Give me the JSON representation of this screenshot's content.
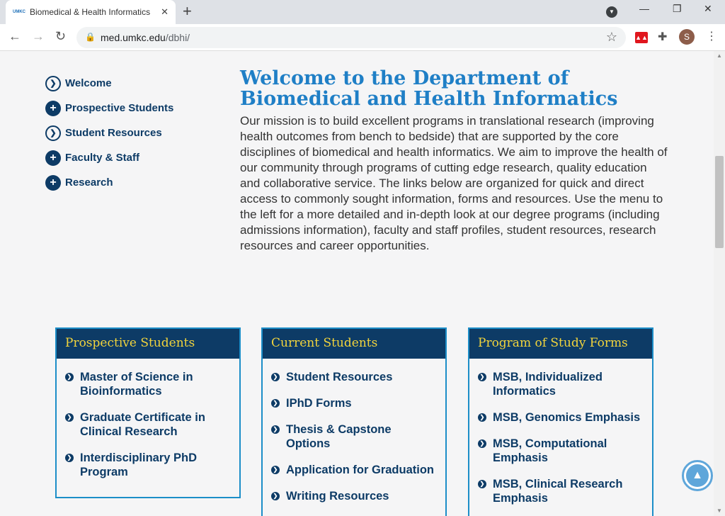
{
  "browser": {
    "tab_title": "Biomedical & Health Informatics",
    "favicon_text": "UMKC",
    "url_host": "med.umkc.edu",
    "url_path": "/dbhi/",
    "avatar_initial": "S"
  },
  "sidebar": {
    "items": [
      {
        "label": "Welcome",
        "icon": "chevron-circle-icon"
      },
      {
        "label": "Prospective Students",
        "icon": "plus-circle-icon"
      },
      {
        "label": "Student Resources",
        "icon": "chevron-circle-icon"
      },
      {
        "label": "Faculty & Staff",
        "icon": "plus-circle-icon"
      },
      {
        "label": "Research",
        "icon": "plus-circle-icon"
      }
    ]
  },
  "main": {
    "heading": "Welcome to the Department of Biomedical and Health Informatics",
    "mission": "Our mission is to build excellent programs in translational research (improving health outcomes from bench to bedside) that are supported by the core disciplines of biomedical and health informatics. We aim to improve the health of our community through programs of cutting edge research, quality education and collaborative service. The links below are organized for quick and direct access to commonly sought information, forms and resources.  Use the menu to the left for a more detailed and in-depth look at our degree programs (including admissions information), faculty and staff profiles, student resources, research resources and career opportunities."
  },
  "cards": [
    {
      "title": "Prospective Students",
      "links": [
        "Master of Science in Bioinformatics",
        "Graduate Certificate in Clinical Research",
        "Interdisciplinary PhD Program"
      ]
    },
    {
      "title": "Current Students",
      "links": [
        "Student Resources",
        "IPhD Forms",
        "Thesis & Capstone Options",
        "Application for Graduation",
        "Writing Resources"
      ]
    },
    {
      "title": "Program of Study Forms",
      "links": [
        "MSB, Individualized Informatics",
        "MSB, Genomics Emphasis",
        "MSB, Computational Emphasis",
        "MSB, Clinical Research Emphasis"
      ]
    }
  ],
  "colors": {
    "navy": "#0d3b66",
    "heading_blue": "#1f7fc6",
    "card_title_gold": "#f2d43c",
    "card_border": "#1c8ec8"
  }
}
